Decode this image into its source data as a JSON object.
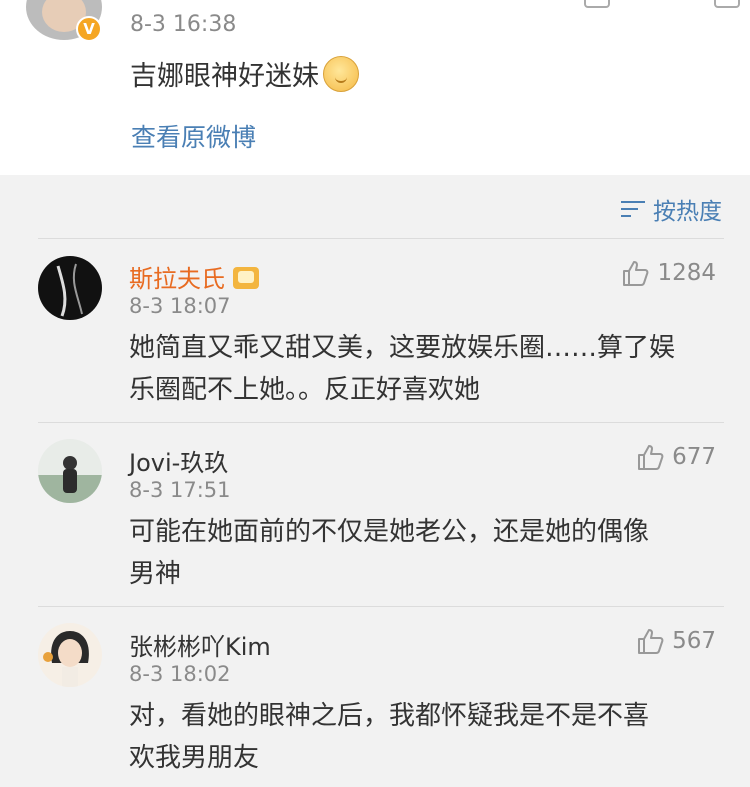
{
  "post": {
    "time": "8-3 16:38",
    "text": "吉娜眼神好迷妹",
    "view_original": "查看原微博",
    "verified_badge": "V"
  },
  "sort": {
    "label": "按热度",
    "icon": "sort-icon"
  },
  "comments": [
    {
      "name": "斯拉夫氏",
      "name_color": "#e86b21",
      "time": "8-3 18:07",
      "likes": "1284",
      "text_line1": "她简直又乖又甜又美，这要放娱乐圈……算了娱",
      "text_line2": "乐圈配不上她。。反正好喜欢她"
    },
    {
      "name": "Jovi-玖玖",
      "name_color": "#333333",
      "time": "8-3 17:51",
      "likes": "677",
      "text_line1": "可能在她面前的不仅是她老公，还是她的偶像",
      "text_line2": "男神"
    },
    {
      "name": "张彬彬吖Kim",
      "name_color": "#333333",
      "time": "8-3 18:02",
      "likes": "567",
      "text_line1": "对，看她的眼神之后，我都怀疑我是不是不喜",
      "text_line2": "欢我男朋友"
    }
  ]
}
